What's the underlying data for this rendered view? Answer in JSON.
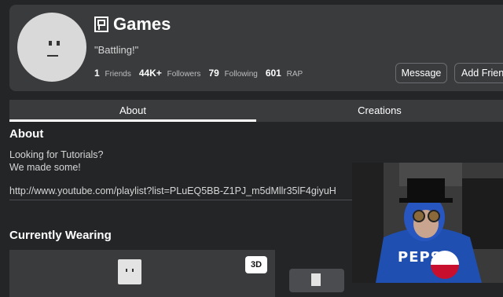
{
  "profile": {
    "title": "Games",
    "status": "\"Battling!\"",
    "stats": [
      {
        "num": "1",
        "label": "Friends"
      },
      {
        "num": "44K+",
        "label": "Followers"
      },
      {
        "num": "79",
        "label": "Following"
      },
      {
        "num": "601",
        "label": "RAP"
      }
    ],
    "buttons": {
      "message": "Message",
      "add_friend": "Add Friend"
    }
  },
  "tabs": [
    {
      "label": "About",
      "active": true
    },
    {
      "label": "Creations",
      "active": false
    }
  ],
  "about": {
    "heading": "About",
    "line1": "Looking for Tutorials?",
    "line2": "We made some!",
    "link": "http://www.youtube.com/playlist?list=PLuEQ5BB-Z1PJ_m5dMllr35lF4giyuH"
  },
  "wearing": {
    "heading": "Currently Wearing",
    "view_3d": "3D"
  },
  "webcam_text": "PEPSI"
}
